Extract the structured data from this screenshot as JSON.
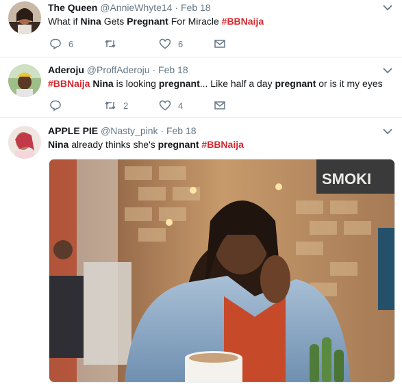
{
  "tweets": [
    {
      "name": "The Queen",
      "handle": "@AnnieWhyte14",
      "dot": "·",
      "date": "Feb 18",
      "text": [
        "What if ",
        "Nina",
        " Gets ",
        "Pregnant",
        " For Miracle ",
        "#BBNaija"
      ],
      "reply_count": "6",
      "retweet_count": "",
      "like_count": "6"
    },
    {
      "name": "Aderoju",
      "handle": "@ProffAderoju",
      "dot": "·",
      "date": "Feb 18",
      "text": [
        "#BBNaija",
        " ",
        "Nina",
        " is looking ",
        "pregnant",
        "... Like half a day ",
        "pregnant",
        " or is it my eyes"
      ],
      "reply_count": "",
      "retweet_count": "2",
      "like_count": "4"
    },
    {
      "name": "APPLE PIE",
      "handle": "@Nasty_pink",
      "dot": "·",
      "date": "Feb 18",
      "text": [
        "Nina",
        " already thinks she's ",
        "pregnant",
        " ",
        "#BBNaija"
      ]
    }
  ],
  "photo": {
    "sign_text": "SMOKI"
  },
  "icons": {
    "reply": "reply-icon",
    "retweet": "retweet-icon",
    "like": "heart-icon",
    "dm": "envelope-icon",
    "caret": "chevron-down-icon"
  },
  "colors": {
    "hashtag": "#d4282f",
    "muted": "#657786",
    "divider": "#e6ecf0"
  }
}
